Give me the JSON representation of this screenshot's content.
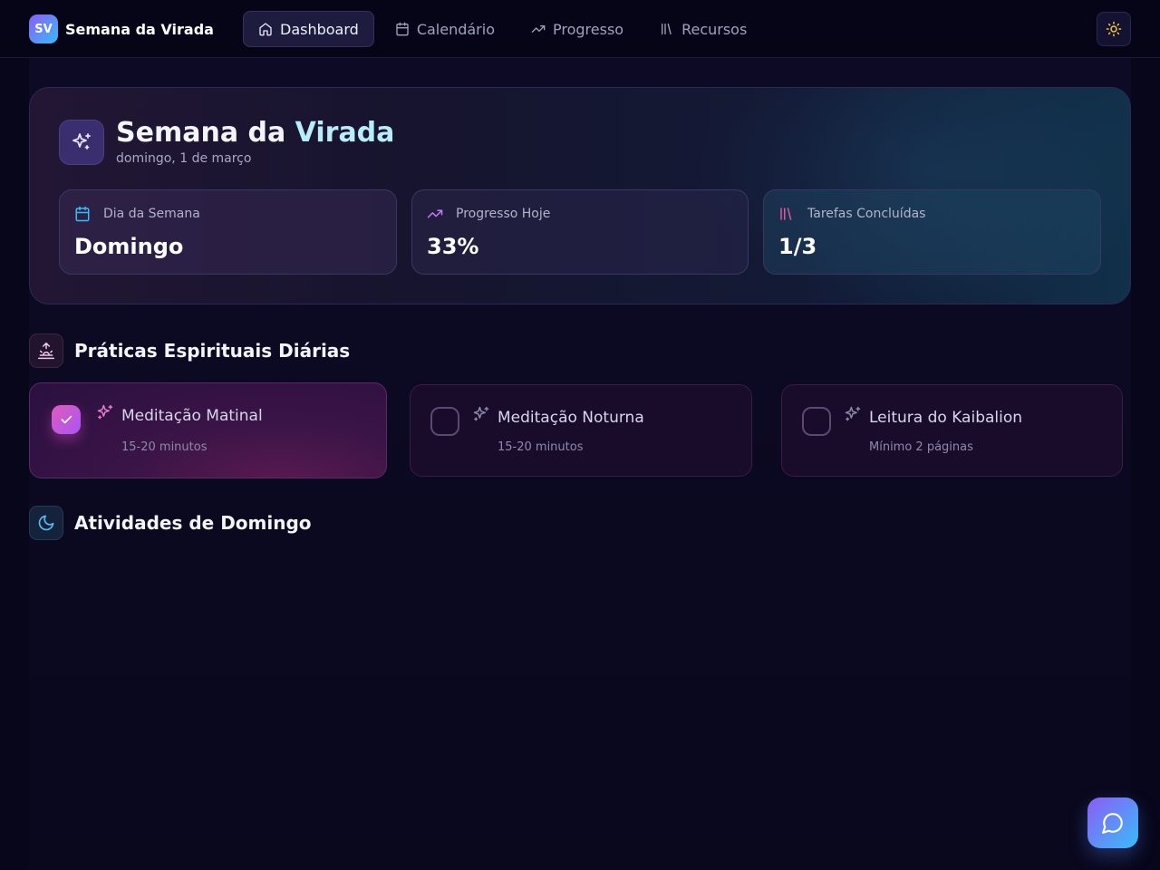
{
  "brand": {
    "logo_text": "SV",
    "name": "Semana da Virada"
  },
  "nav": {
    "items": [
      {
        "label": "Dashboard",
        "icon": "home-icon",
        "active": true
      },
      {
        "label": "Calendário",
        "icon": "calendar-icon",
        "active": false
      },
      {
        "label": "Progresso",
        "icon": "trending-up-icon",
        "active": false
      },
      {
        "label": "Recursos",
        "icon": "library-icon",
        "active": false
      }
    ]
  },
  "hero": {
    "title_main": "Semana da ",
    "title_accent": "Virada",
    "subtitle": "domingo, 1 de março",
    "stats": [
      {
        "label": "Dia da Semana",
        "value": "Domingo",
        "icon": "calendar-icon"
      },
      {
        "label": "Progresso Hoje",
        "value": "33%",
        "icon": "trending-up-icon"
      },
      {
        "label": "Tarefas Concluídas",
        "value": "1/3",
        "icon": "library-icon"
      }
    ]
  },
  "sections": {
    "practices": {
      "title": "Práticas Espirituais Diárias",
      "icon": "sunrise-icon",
      "items": [
        {
          "title": "Meditação Matinal",
          "subtitle": "15-20 minutos",
          "done": true
        },
        {
          "title": "Meditação Noturna",
          "subtitle": "15-20 minutos",
          "done": false
        },
        {
          "title": "Leitura do Kaibalion",
          "subtitle": "Mínimo 2 páginas",
          "done": false
        }
      ]
    },
    "activities": {
      "title": "Atividades de Domingo",
      "icon": "moon-icon"
    }
  },
  "colors": {
    "background": "#07061a",
    "accent_pink": "#e15bbb",
    "accent_blue": "#38bdf8",
    "accent_purple": "#8b5cf6",
    "title_accent": "#b8ecf8"
  }
}
